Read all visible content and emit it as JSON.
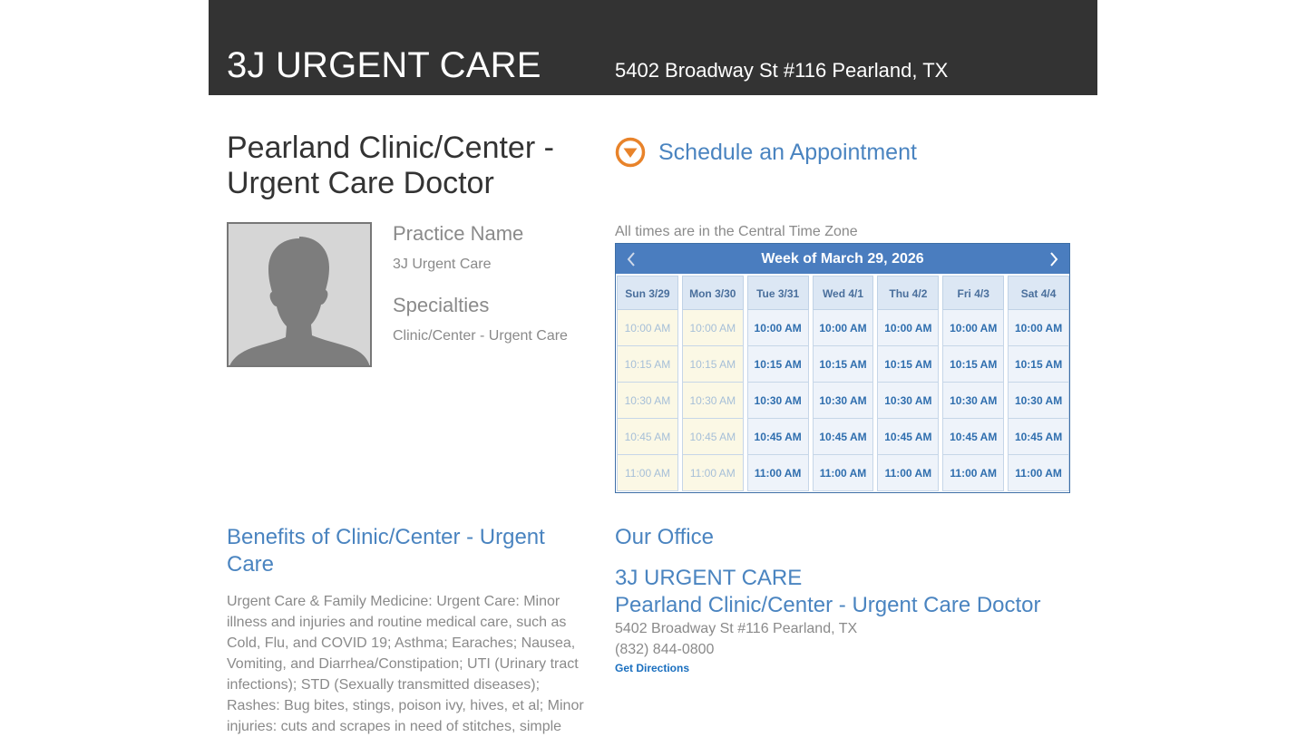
{
  "header": {
    "brand": "3J URGENT CARE",
    "address": "5402 Broadway St #116 Pearland, TX",
    "background": "#333333"
  },
  "doctor": {
    "title": "Pearland Clinic/Center - Urgent Care Doctor",
    "photo_icon": "avatar-silhouette-icon",
    "practice_label": "Practice Name",
    "practice_value": "3J Urgent Care",
    "specialties_label": "Specialties",
    "specialties_value": "Clinic/Center - Urgent Care"
  },
  "schedule": {
    "icon": "chevron-down-circle-icon",
    "label": "Schedule an Appointment",
    "timezone_note": "All times are in the Central Time Zone",
    "week_title": "Week of March 29, 2026",
    "prev_icon": "chevron-left-icon",
    "next_icon": "chevron-right-icon",
    "days": [
      {
        "label": "Sun 3/29",
        "available": false,
        "slots": [
          "10:00 AM",
          "10:15 AM",
          "10:30 AM",
          "10:45 AM",
          "11:00 AM"
        ]
      },
      {
        "label": "Mon 3/30",
        "available": false,
        "slots": [
          "10:00 AM",
          "10:15 AM",
          "10:30 AM",
          "10:45 AM",
          "11:00 AM"
        ]
      },
      {
        "label": "Tue 3/31",
        "available": true,
        "slots": [
          "10:00 AM",
          "10:15 AM",
          "10:30 AM",
          "10:45 AM",
          "11:00 AM"
        ]
      },
      {
        "label": "Wed 4/1",
        "available": true,
        "slots": [
          "10:00 AM",
          "10:15 AM",
          "10:30 AM",
          "10:45 AM",
          "11:00 AM"
        ]
      },
      {
        "label": "Thu 4/2",
        "available": true,
        "slots": [
          "10:00 AM",
          "10:15 AM",
          "10:30 AM",
          "10:45 AM",
          "11:00 AM"
        ]
      },
      {
        "label": "Fri 4/3",
        "available": true,
        "slots": [
          "10:00 AM",
          "10:15 AM",
          "10:30 AM",
          "10:45 AM",
          "11:00 AM"
        ]
      },
      {
        "label": "Sat 4/4",
        "available": true,
        "slots": [
          "10:00 AM",
          "10:15 AM",
          "10:30 AM",
          "10:45 AM",
          "11:00 AM"
        ]
      }
    ]
  },
  "benefits": {
    "title": "Benefits of Clinic/Center - Urgent Care",
    "body": "Urgent Care & Family Medicine: Urgent Care: Minor illness and injuries and routine medical care, such as Cold, Flu, and COVID 19; Asthma; Earaches; Nausea, Vomiting, and Diarrhea/Constipation; UTI (Urinary tract infections); STD (Sexually transmitted diseases); Rashes: Bug bites, stings, poison ivy, hives, et al; Minor injuries: cuts and scrapes in need of stitches, simple"
  },
  "office": {
    "title": "Our Office",
    "name": "3J URGENT CARE",
    "subtitle": "Pearland Clinic/Center - Urgent Care Doctor",
    "address": "5402 Broadway St #116 Pearland, TX",
    "phone": "(832) 844-0800",
    "directions_label": "Get Directions"
  },
  "colors": {
    "accent": "#4a84c0",
    "calendar_header": "#4a7dbf",
    "schedule_icon": "#e8832a"
  }
}
